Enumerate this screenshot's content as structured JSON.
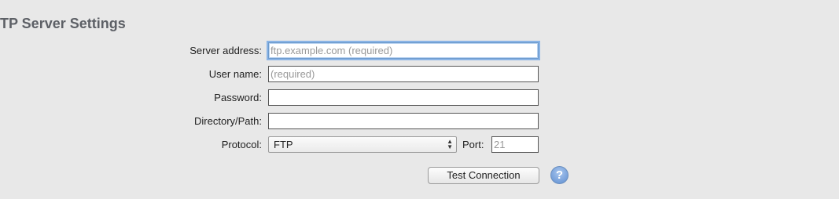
{
  "section": {
    "title": "TP Server Settings"
  },
  "fields": {
    "server_address": {
      "label": "Server address:",
      "value": "",
      "placeholder": "ftp.example.com (required)"
    },
    "user_name": {
      "label": "User name:",
      "value": "",
      "placeholder": "(required)"
    },
    "password": {
      "label": "Password:",
      "value": ""
    },
    "directory": {
      "label": "Directory/Path:",
      "value": ""
    },
    "protocol": {
      "label": "Protocol:",
      "selected": "FTP"
    },
    "port": {
      "label": "Port:",
      "placeholder": "21"
    }
  },
  "actions": {
    "test_connection": "Test Connection",
    "help": "?"
  }
}
